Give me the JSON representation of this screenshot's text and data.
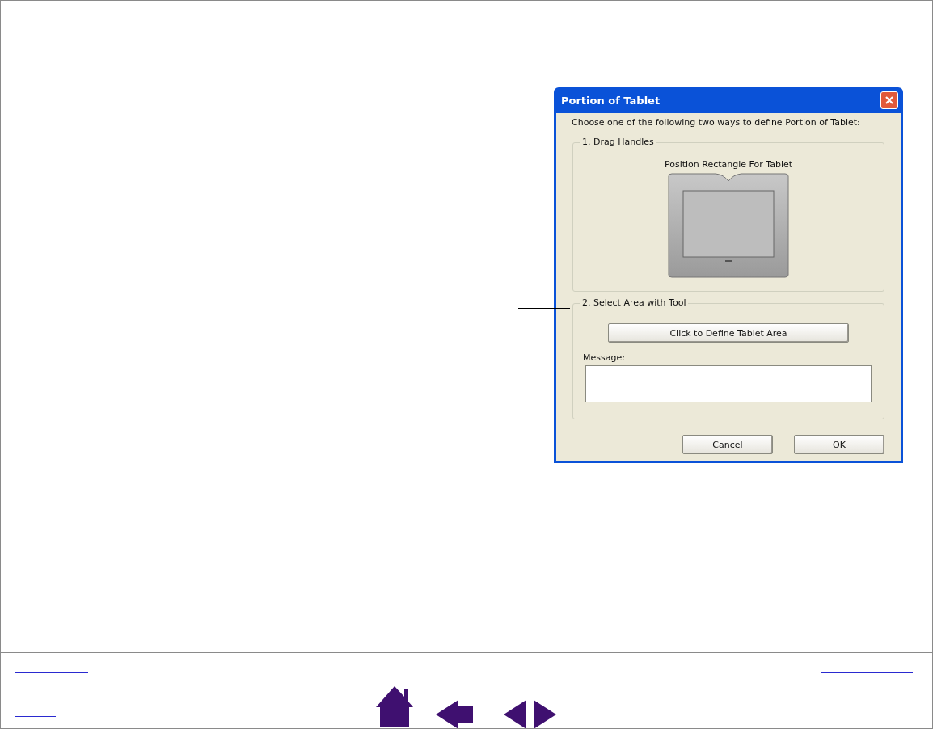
{
  "dialog": {
    "title": "Portion of Tablet",
    "intro": "Choose one of the following  two ways to define Portion of Tablet:",
    "groups": [
      {
        "kind": "image",
        "legend": "1. Drag Handles",
        "caption": "Position Rectangle For Tablet"
      },
      {
        "kind": "tool",
        "legend": "2. Select Area with Tool",
        "button": "Click to Define Tablet Area",
        "field_label": "Message:"
      }
    ],
    "buttons": [
      "Cancel",
      "OK"
    ]
  }
}
